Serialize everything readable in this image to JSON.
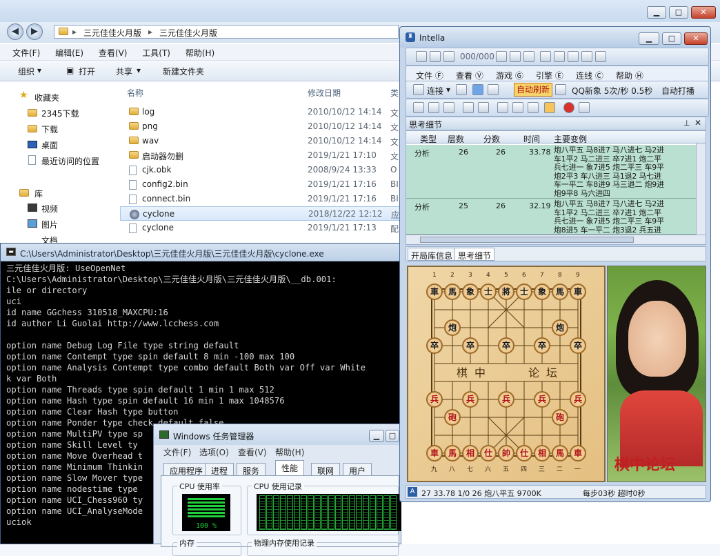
{
  "explorer": {
    "breadcrumb": [
      "三元佳佳火月版",
      "三元佳佳火月版"
    ],
    "menu": [
      "文件(F)",
      "编辑(E)",
      "查看(V)",
      "工具(T)",
      "帮助(H)"
    ],
    "commands": {
      "organize": "组织",
      "open": "打开",
      "share": "共享",
      "new_folder": "新建文件夹"
    },
    "nav": {
      "favorites": "收藏夹",
      "items": [
        "2345下载",
        "下载",
        "桌面",
        "最近访问的位置"
      ],
      "library": "库",
      "lib_items": [
        "视频",
        "图片",
        "文档"
      ]
    },
    "columns": {
      "name": "名称",
      "date": "修改日期",
      "type": "类"
    },
    "files": [
      {
        "name": "log",
        "date": "2010/10/12 14:14",
        "type": "文",
        "kind": "folder"
      },
      {
        "name": "png",
        "date": "2010/10/12 14:14",
        "type": "文",
        "kind": "folder"
      },
      {
        "name": "wav",
        "date": "2010/10/12 14:14",
        "type": "文",
        "kind": "folder"
      },
      {
        "name": "启动器勿删",
        "date": "2019/1/21 17:10",
        "type": "文",
        "kind": "folder"
      },
      {
        "name": "cjk.obk",
        "date": "2008/9/24 13:33",
        "type": "O",
        "kind": "file"
      },
      {
        "name": "config2.bin",
        "date": "2019/1/21 17:16",
        "type": "BI",
        "kind": "file"
      },
      {
        "name": "connect.bin",
        "date": "2019/1/21 17:16",
        "type": "BI",
        "kind": "file"
      },
      {
        "name": "cyclone",
        "date": "2018/12/22 12:12",
        "type": "应",
        "kind": "exe",
        "selected": true
      },
      {
        "name": "cyclone",
        "date": "2019/1/21 17:13",
        "type": "配",
        "kind": "file"
      }
    ]
  },
  "console": {
    "title": "C:\\Users\\Administrator\\Desktop\\三元佳佳火月版\\三元佳佳火月版\\cyclone.exe",
    "lines": [
      "三元佳佳火月版: UseOpenNet",
      "C:\\Users\\Administrator\\Desktop\\三元佳佳火月版\\三元佳佳火月版\\__db.001:",
      "ile or directory",
      "uci",
      "id name GGchess 310518_MAXCPU:16",
      "id author Li Guolai http://www.lcchess.com",
      "",
      "option name Debug Log File type string default",
      "option name Contempt type spin default 8 min -100 max 100",
      "option name Analysis Contempt type combo default Both var Off var White",
      "k var Both",
      "option name Threads type spin default 1 min 1 max 512",
      "option name Hash type spin default 16 min 1 max 1048576",
      "option name Clear Hash type button",
      "option name Ponder type check default false",
      "option name MultiPV type sp",
      "option name Skill Level ty",
      "option name Move Overhead t",
      "option name Minimum Thinkin",
      "option name Slow Mover type",
      "option name nodestime type",
      "option name UCI_Chess960 ty",
      "option name UCI_AnalyseMode",
      "uciok"
    ]
  },
  "taskmgr": {
    "title": "Windows 任务管理器",
    "menu": [
      "文件(F)",
      "选项(O)",
      "查看(V)",
      "帮助(H)"
    ],
    "tabs": [
      "应用程序",
      "进程",
      "服务",
      "性能",
      "联网",
      "用户"
    ],
    "cpu_usage_label": "CPU 使用率",
    "cpu_history_label": "CPU 使用记录",
    "cpu_pct": "100 %",
    "mem_label": "内存",
    "mem_history_label": "物理内存使用记录"
  },
  "intella": {
    "title": "Intella",
    "counter": "000/000",
    "menu": [
      "文件 Ⓕ",
      "查看 Ⓥ",
      "游戏 Ⓖ",
      "引擎 Ⓔ",
      "连线 Ⓒ",
      "帮助 Ⓗ"
    ],
    "connect": "连接",
    "auto_refresh": "自动刷新",
    "qq_status": "QQ新象 5次/秒 0.5秒",
    "auto_play": "自动打播",
    "panel_title": "思考细节",
    "columns": [
      "类型",
      "层数",
      "分数",
      "时间",
      "主要变例"
    ],
    "rows": [
      {
        "type": "分析",
        "depth": "26",
        "score": "26",
        "time": "33.78",
        "pv": "炮八平五 马8进7 马八进七 马2进\n车1平2 马二进三 卒7进1 炮二平\n兵七进一 象7进5 炮二平三 车9平\n炮2平3 车八进三 马1退2 马七进\n车一平二 车8进9 马三退二 炮9进\n炮9平8 马六进四"
      },
      {
        "type": "分析",
        "depth": "25",
        "score": "26",
        "time": "32.19",
        "pv": "炮八平五 马8进7 马八进七 马2进\n车1平2 马二进三 卒7进1 炮二平\n兵七进一 象7进5 炮二平三 车9平\n炮8进5 车一平二 炮3退2 兵五进"
      }
    ],
    "tabs": [
      "开局库信息",
      "思考细节"
    ],
    "board_top_nums": [
      "1",
      "2",
      "3",
      "4",
      "5",
      "6",
      "7",
      "8",
      "9"
    ],
    "board_bottom_nums": [
      "九",
      "八",
      "七",
      "六",
      "五",
      "四",
      "三",
      "二",
      "一"
    ],
    "river_text": [
      "棋",
      "中",
      "论",
      "坛"
    ],
    "photo_logo": "棋中论坛",
    "status": {
      "line": "27 33.78 1/0 26 炮八平五  9700K",
      "timer": "每步03秒  超时0秒"
    }
  }
}
